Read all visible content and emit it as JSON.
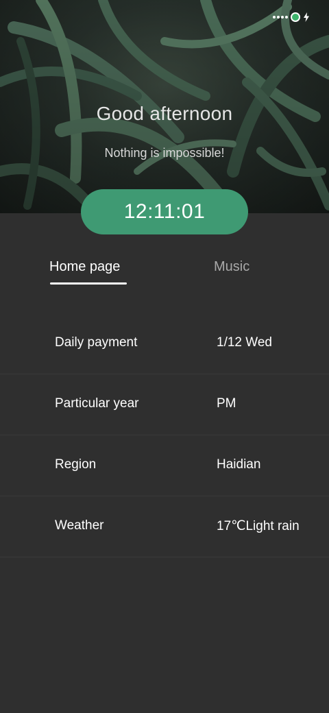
{
  "status_bar": {
    "signal_icon": "signal-dots-icon",
    "battery_icon": "battery-icon",
    "charging_icon": "bolt-icon",
    "battery_color": "#3db36b"
  },
  "header": {
    "greeting": "Good afternoon",
    "motto": "Nothing is impossible!",
    "clock": "12:11:01",
    "clock_color": "#3f9a73"
  },
  "tabs": [
    {
      "label": "Home page",
      "active": true
    },
    {
      "label": "Music",
      "active": false
    }
  ],
  "info_rows": [
    {
      "label": "Daily payment",
      "value": "1/12 Wed"
    },
    {
      "label": "Particular year",
      "value": "PM"
    },
    {
      "label": "Region",
      "value": "Haidian"
    },
    {
      "label": "Weather",
      "value": "17℃Light rain"
    }
  ]
}
